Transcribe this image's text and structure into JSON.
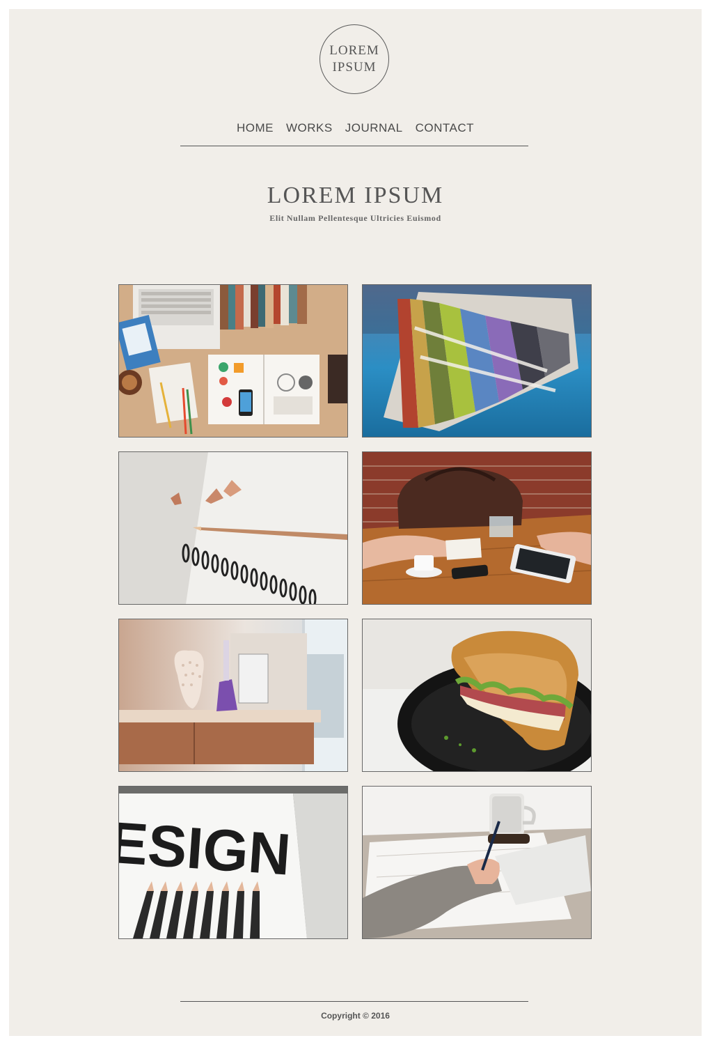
{
  "logo": {
    "line1": "LOREM",
    "line2": "IPSUM"
  },
  "nav": {
    "items": [
      {
        "label": "HOME"
      },
      {
        "label": "WORKS"
      },
      {
        "label": "JOURNAL"
      },
      {
        "label": "CONTACT"
      }
    ]
  },
  "hero": {
    "title": "LOREM IPSUM",
    "subtitle": "Elit Nullam Pellentesque Ultricies Euismod"
  },
  "gallery": {
    "tiles": [
      {
        "subject": "designer-desk-laptop-books"
      },
      {
        "subject": "color-swatch-fan"
      },
      {
        "subject": "notebook-pencil-shavings"
      },
      {
        "subject": "table-meeting-bag-coffee"
      },
      {
        "subject": "vase-shelf-interior"
      },
      {
        "subject": "croissant-sandwich-plate"
      },
      {
        "subject": "design-poster-pencils",
        "visible_text": "ESIGN"
      },
      {
        "subject": "writing-hand-coffee-cup"
      }
    ]
  },
  "footer": {
    "copyright": "Copyright © 2016"
  }
}
